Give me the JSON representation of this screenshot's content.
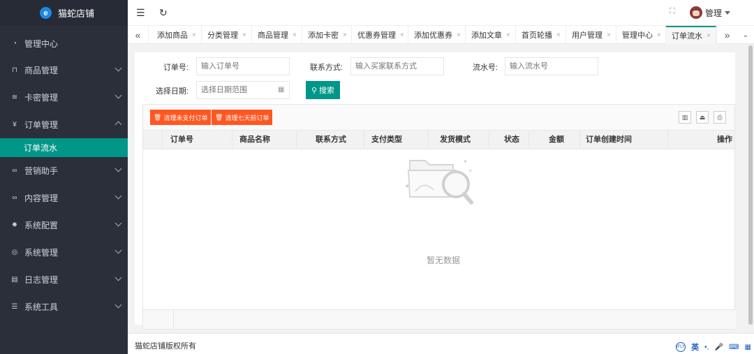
{
  "app": {
    "title": "猫蛇店铺",
    "logo_letter": "e"
  },
  "sidebar": {
    "items": [
      {
        "label": "管理中心",
        "icon": "dashboard-icon",
        "expandable": false
      },
      {
        "label": "商品管理",
        "icon": "cart-icon",
        "expandable": true
      },
      {
        "label": "卡密管理",
        "icon": "layers-icon",
        "expandable": true
      },
      {
        "label": "订单管理",
        "icon": "yen-icon",
        "expandable": true,
        "expanded": true
      },
      {
        "label": "营销助手",
        "icon": "link-icon",
        "expandable": true
      },
      {
        "label": "内容管理",
        "icon": "link-icon",
        "expandable": true
      },
      {
        "label": "系统配置",
        "icon": "gear-icon",
        "expandable": true
      },
      {
        "label": "系统管理",
        "icon": "settings-icon",
        "expandable": true
      },
      {
        "label": "日志管理",
        "icon": "file-icon",
        "expandable": true
      },
      {
        "label": "系统工具",
        "icon": "sliders-icon",
        "expandable": true
      }
    ],
    "active_subitem": "订单流水"
  },
  "topbar": {
    "user_name": "管理"
  },
  "tabs": {
    "items": [
      {
        "label": "添加商品",
        "close": "×"
      },
      {
        "label": "分类管理",
        "close": "×"
      },
      {
        "label": "商品管理",
        "close": "×"
      },
      {
        "label": "添加卡密",
        "close": "×"
      },
      {
        "label": "优惠券管理",
        "close": "×"
      },
      {
        "label": "添加优惠券",
        "close": "×"
      },
      {
        "label": "添加文章",
        "close": "×"
      },
      {
        "label": "首页轮播",
        "close": "×"
      },
      {
        "label": "用户管理",
        "close": "×"
      },
      {
        "label": "管理中心",
        "close": "×"
      },
      {
        "label": "订单流水",
        "close": "×",
        "active": true
      }
    ]
  },
  "filters": {
    "order_no": {
      "label": "订单号:",
      "placeholder": "输入订单号"
    },
    "contact": {
      "label": "联系方式:",
      "placeholder": "输入买家联系方式"
    },
    "serial": {
      "label": "流水号:",
      "placeholder": "输入流水号"
    },
    "date": {
      "label": "选择日期:",
      "placeholder": "选择日期范围"
    },
    "search_label": "搜索"
  },
  "toolbar": {
    "clear_unpaid": "清理未支付订单",
    "clear_7days": "清理七天前订单"
  },
  "table": {
    "columns": [
      "订单号",
      "商品名称",
      "联系方式",
      "支付类型",
      "发货模式",
      "状态",
      "金额",
      "订单创建时间",
      "操作"
    ],
    "rows": [],
    "empty_text": "暂无数据"
  },
  "footer": {
    "copyright": "猫蛇店铺版权所有"
  },
  "ime": {
    "mode": "英"
  }
}
